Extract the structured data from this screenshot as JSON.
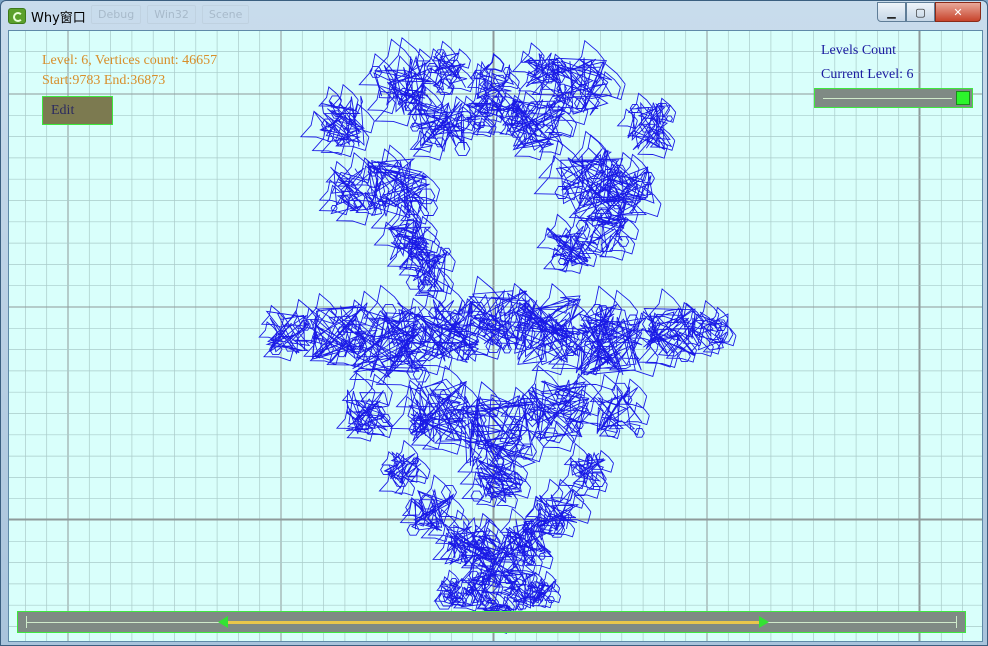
{
  "window": {
    "title": "Why窗口"
  },
  "background_toolbar": [
    "Debug",
    "Win32",
    "Scene"
  ],
  "window_controls": {
    "minimize": "▁",
    "maximize": "▢",
    "close": "✕"
  },
  "info": {
    "line1": "Level: 6, Vertices count: 46657",
    "line2": "Start:9783 End:36873",
    "text_color": "#d88e2a"
  },
  "edit_button": {
    "label": "Edit"
  },
  "levels_panel": {
    "title": "Levels Count",
    "current": "Current Level: 6",
    "slider_value": 1.0,
    "text_color": "#1a1aa0"
  },
  "range_slider": {
    "start": 0.216,
    "end": 0.786
  },
  "fractal": {
    "stroke_color": "#1a1ae6",
    "type": "fractal-curve"
  },
  "colors": {
    "canvas_bg": "#d9fffb",
    "grid_minor": "#a9cbc9",
    "grid_major": "#8e9a9a",
    "control_bg": "#7f8a84",
    "control_border": "#3ee83e"
  }
}
